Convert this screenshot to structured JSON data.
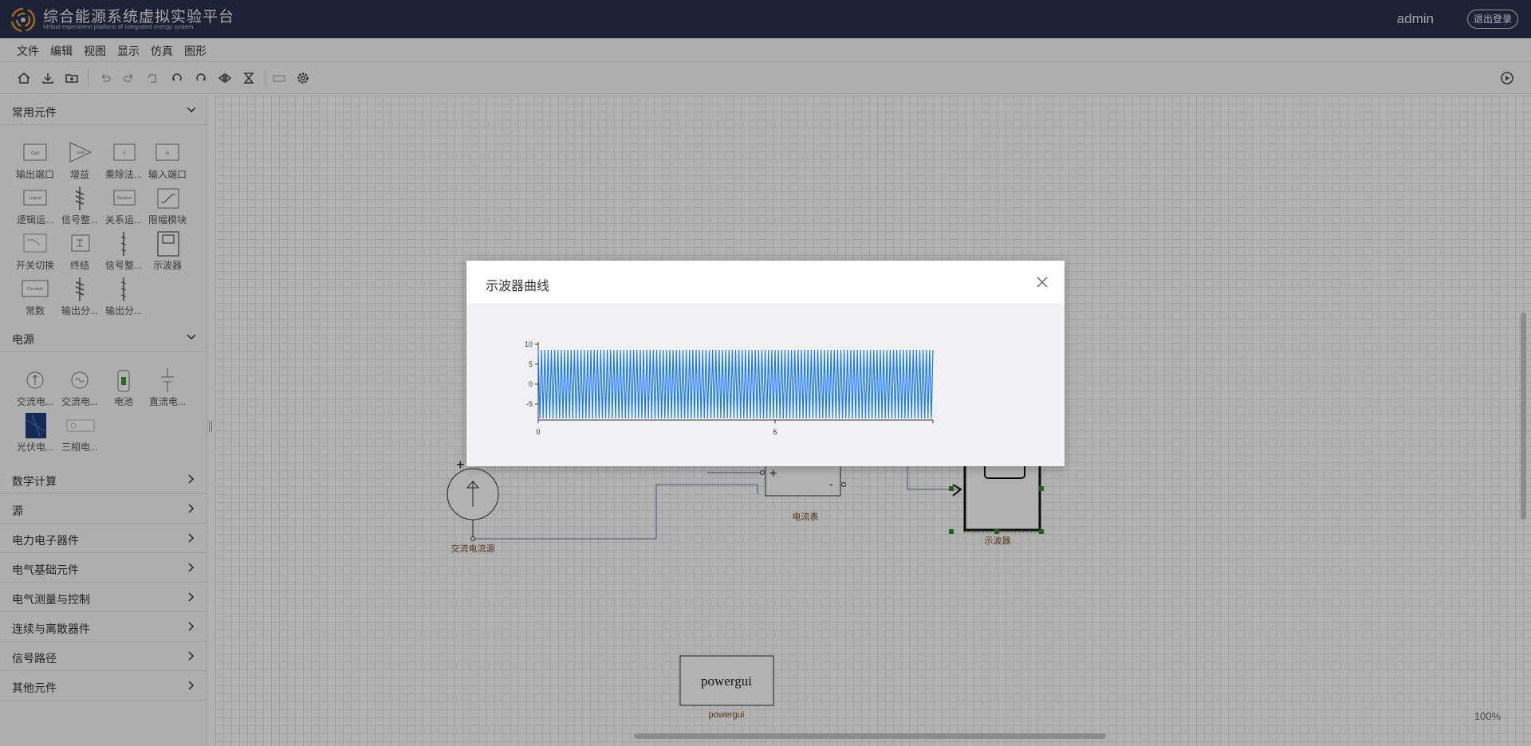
{
  "header": {
    "title": "综合能源系统虚拟实验平台",
    "subtitle": "Virtual experiment platform of integrated energy system",
    "user": "admin",
    "logout_label": "退出登录"
  },
  "menu": [
    "文件",
    "编辑",
    "视图",
    "显示",
    "仿真",
    "图形"
  ],
  "toolbar": {
    "icons": [
      "home-icon",
      "download-icon",
      "open-folder-icon",
      "undo-icon",
      "redo-icon",
      "delete-icon",
      "rotate-left-icon",
      "rotate-right-icon",
      "flip-horizontal-icon",
      "flip-vertical-icon",
      "group-icon",
      "settings-icon",
      "run-simulation-icon"
    ]
  },
  "sidebar": {
    "sections": [
      {
        "label": "常用元件",
        "expanded": true,
        "items": [
          {
            "label": "输出端口",
            "icon_text": "Out"
          },
          {
            "label": "增益",
            "icon_text": "Gain"
          },
          {
            "label": "乘除法...",
            "icon_text": "×"
          },
          {
            "label": "输入端口",
            "icon_text": "In"
          },
          {
            "label": "逻辑运...",
            "icon_text": "Logical"
          },
          {
            "label": "信号整...",
            "icon_text": ""
          },
          {
            "label": "关系运...",
            "icon_text": "Relation"
          },
          {
            "label": "限幅模块",
            "icon_text": ""
          },
          {
            "label": "开关切换",
            "icon_text": ""
          },
          {
            "label": "终结",
            "icon_text": ""
          },
          {
            "label": "信号整...",
            "icon_text": ""
          },
          {
            "label": "示波器",
            "icon_text": ""
          },
          {
            "label": "常数",
            "icon_text": "Constant"
          },
          {
            "label": "输出分...",
            "icon_text": ""
          },
          {
            "label": "输出分...",
            "icon_text": ""
          }
        ]
      },
      {
        "label": "电源",
        "expanded": true,
        "items": [
          {
            "label": "交流电...",
            "icon_text": ""
          },
          {
            "label": "交流电...",
            "icon_text": ""
          },
          {
            "label": "电池",
            "icon_text": ""
          },
          {
            "label": "直流电...",
            "icon_text": ""
          },
          {
            "label": "光伏电...",
            "icon_text": ""
          },
          {
            "label": "三相电...",
            "icon_text": ""
          }
        ]
      },
      {
        "label": "数学计算",
        "expanded": false
      },
      {
        "label": "源",
        "expanded": false
      },
      {
        "label": "电力电子器件",
        "expanded": false
      },
      {
        "label": "电气基础元件",
        "expanded": false
      },
      {
        "label": "电气测量与控制",
        "expanded": false
      },
      {
        "label": "连续与离散器件",
        "expanded": false
      },
      {
        "label": "信号路径",
        "expanded": false
      },
      {
        "label": "其他元件",
        "expanded": false
      }
    ]
  },
  "canvas": {
    "zoom": "100%",
    "blocks": {
      "ac_source": "交流电流源",
      "ammeter": "电流表",
      "scope": "示波器",
      "powergui_box": "powergui",
      "powergui_label": "powergui"
    }
  },
  "modal": {
    "title": "示波器曲线"
  },
  "chart_data": {
    "type": "line",
    "title": "",
    "xlabel": "",
    "ylabel": "",
    "xlim": [
      0,
      10
    ],
    "ylim": [
      -9,
      10
    ],
    "xticks": [
      "0",
      "6"
    ],
    "yticks": [
      "10",
      "5",
      "0",
      "-5"
    ],
    "grid": false,
    "series": [
      {
        "color": "#1677ff",
        "amplitude": 8.6,
        "cycles": 120,
        "description": "dense oscillation filling band"
      }
    ]
  }
}
